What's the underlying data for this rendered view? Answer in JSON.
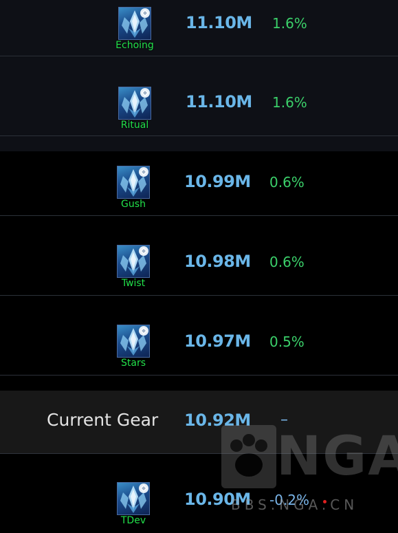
{
  "rows": [
    {
      "name": "Echoing",
      "dps": "11.10M",
      "pct": "1.6%"
    },
    {
      "name": "Ritual",
      "dps": "11.10M",
      "pct": "1.6%"
    },
    {
      "name": "Gush",
      "dps": "10.99M",
      "pct": "0.6%"
    },
    {
      "name": "Twist",
      "dps": "10.98M",
      "pct": "0.6%"
    },
    {
      "name": "Stars",
      "dps": "10.97M",
      "pct": "0.5%"
    },
    {
      "name": "Current Gear",
      "dps": "10.92M",
      "pct": "–"
    },
    {
      "name": "TDev",
      "dps": "10.90M",
      "pct": "-0.2%"
    }
  ],
  "watermark": {
    "brand": "NGA",
    "url": "BBS.NGA.CN"
  },
  "colors": {
    "dps": "#6ab6e8",
    "gain": "#3bd06a",
    "loss": "#79b4e8",
    "gem_label": "#22e04a"
  },
  "icon": "frost-gem-icon"
}
